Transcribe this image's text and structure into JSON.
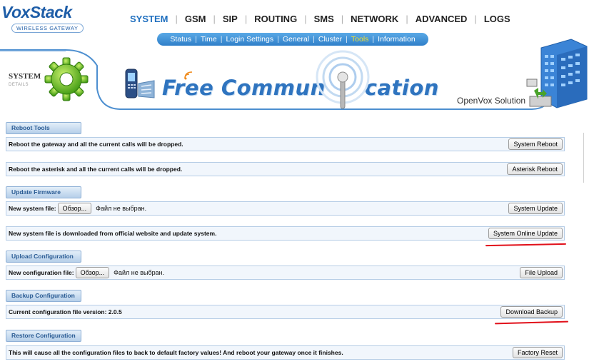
{
  "logo": {
    "name": "VoxStack",
    "subtitle": "WIRELESS GATEWAY"
  },
  "main_nav": [
    {
      "label": "SYSTEM",
      "active": true
    },
    {
      "label": "GSM"
    },
    {
      "label": "SIP"
    },
    {
      "label": "ROUTING"
    },
    {
      "label": "SMS"
    },
    {
      "label": "NETWORK"
    },
    {
      "label": "ADVANCED"
    },
    {
      "label": "LOGS"
    }
  ],
  "sub_nav": [
    {
      "label": "Status"
    },
    {
      "label": "Time"
    },
    {
      "label": "Login Settings"
    },
    {
      "label": "General"
    },
    {
      "label": "Cluster"
    },
    {
      "label": "Tools",
      "active": true
    },
    {
      "label": "Information"
    }
  ],
  "banner": {
    "system_label": "SYSTEM",
    "details_label": "DETAILS",
    "title_part1": "Free Commun",
    "title_part2": "cation",
    "brand": "OpenVox Solution"
  },
  "sections": {
    "reboot": {
      "title": "Reboot Tools",
      "system_text": "Reboot the gateway and all the current calls will be dropped.",
      "system_button": "System Reboot",
      "asterisk_text": "Reboot the asterisk and all the current calls will be dropped.",
      "asterisk_button": "Asterisk Reboot"
    },
    "firmware": {
      "title": "Update Firmware",
      "file_label": "New system file:",
      "browse_button": "Обзор...",
      "file_status": "Файл не выбран.",
      "update_button": "System Update",
      "online_text": "New system file is downloaded from official website and update system.",
      "online_button": "System Online Update"
    },
    "upload": {
      "title": "Upload Configuration",
      "file_label": "New configuration file:",
      "browse_button": "Обзор...",
      "file_status": "Файл не выбран.",
      "upload_button": "File Upload"
    },
    "backup": {
      "title": "Backup Configuration",
      "version_text": "Current configuration file version: 2.0.5",
      "download_button": "Download Backup"
    },
    "restore": {
      "title": "Restore Configuration",
      "text": "This will cause all the configuration files to back to default factory values! And reboot your gateway once it finishes.",
      "reset_button": "Factory Reset"
    }
  },
  "colors": {
    "brand_blue": "#1f6fbf",
    "subnav_active": "#f5e02a",
    "annotation_red": "#e1101a"
  }
}
